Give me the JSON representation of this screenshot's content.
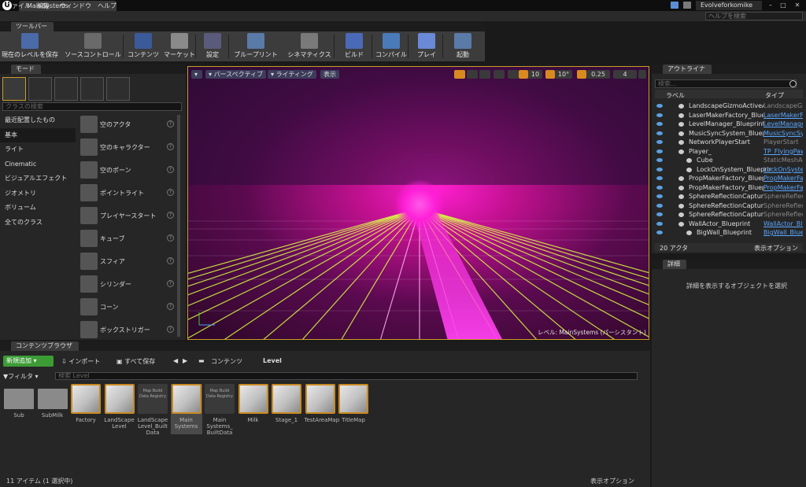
{
  "titlebar": {
    "tab": "MainSystems",
    "user": "Evolveforkomike",
    "help_placeholder": "ヘルプを検索"
  },
  "menu": [
    "ファイル",
    "編集",
    "ウィンドウ",
    "ヘルプ"
  ],
  "toolbar": {
    "header": "ツールバー",
    "buttons": [
      {
        "label": "現在のレベルを保存",
        "icon": "save-icon",
        "color": "#4a6aa8"
      },
      {
        "label": "ソースコントロール",
        "icon": "source-control-icon",
        "color": "#6a6a6a"
      },
      {
        "label": "コンテンツ",
        "icon": "content-icon",
        "color": "#3a5a9a"
      },
      {
        "label": "マーケット",
        "icon": "marketplace-icon",
        "color": "#8a8a8a"
      },
      {
        "label": "設定",
        "icon": "settings-icon",
        "color": "#5a5a7a"
      },
      {
        "label": "ブループリント",
        "icon": "blueprint-icon",
        "color": "#5a7aa8"
      },
      {
        "label": "シネマティクス",
        "icon": "cinematics-icon",
        "color": "#7a7a7a"
      },
      {
        "label": "ビルド",
        "icon": "build-icon",
        "color": "#4a6ab8"
      },
      {
        "label": "コンパイル",
        "icon": "compile-icon",
        "color": "#4a7ab8"
      },
      {
        "label": "プレイ",
        "icon": "play-icon",
        "color": "#6a8ad8"
      },
      {
        "label": "起動",
        "icon": "launch-icon",
        "color": "#5a7aa8"
      }
    ]
  },
  "modes": {
    "header": "モード",
    "search_placeholder": "クラスの検索",
    "categories": [
      "最近配置したもの",
      "基本",
      "ライト",
      "Cinematic",
      "ビジュアルエフェクト",
      "ジオメトリ",
      "ボリューム",
      "全てのクラス"
    ],
    "items": [
      "空のアクタ",
      "空のキャラクター",
      "空のポーン",
      "ポイントライト",
      "プレイヤースタート",
      "キューブ",
      "スフィア",
      "シリンダー",
      "コーン",
      "ボックストリガー"
    ]
  },
  "viewport": {
    "perspective": "パースペクティブ",
    "lighting": "ライティング",
    "show": "表示",
    "grid": "10",
    "angle": "10°",
    "scale": "0.25",
    "cam": "4",
    "level_label": "レベル: MainSystems (パーシスタント)"
  },
  "outliner": {
    "header": "アウトライナ",
    "search_placeholder": "検索...",
    "col_label": "ラベル",
    "col_type": "タイプ",
    "rows": [
      {
        "label": "LandscapeGizmoActiveActor",
        "type": "LandscapeGizmo",
        "link": false
      },
      {
        "label": "LaserMakerFactory_Blueprint",
        "type": "LaserMakerFac",
        "link": true
      },
      {
        "label": "LevelManager_Blueprint",
        "type": "LevelManager",
        "link": true
      },
      {
        "label": "MusicSyncSystem_Blueprint",
        "type": "MusicSyncSy",
        "link": true
      },
      {
        "label": "NetworkPlayerStart",
        "type": "PlayerStart",
        "link": false
      },
      {
        "label": "Player_",
        "type": "TP_FlyingPaw",
        "link": true
      },
      {
        "label": "Cube",
        "type": "StaticMeshActo",
        "link": false
      },
      {
        "label": "LockOnSystem_Blueprint",
        "type": "LockOnSyster",
        "link": true
      },
      {
        "label": "PropMakerFactory_Blueprint",
        "type": "PropMakerFac",
        "link": true
      },
      {
        "label": "PropMakerFactory_Blueprint",
        "type": "PropMakerFac",
        "link": true
      },
      {
        "label": "SphereReflectionCaptureCer",
        "type": "SphereReflecti",
        "link": false
      },
      {
        "label": "SphereReflectionCaptureLef",
        "type": "SphereReflecti",
        "link": false
      },
      {
        "label": "SphereReflectionCaptureRig",
        "type": "SphereReflecti",
        "link": false
      },
      {
        "label": "WallActor_Blueprint",
        "type": "WallActor_Blu",
        "link": true
      },
      {
        "label": "BigWall_Blueprint",
        "type": "BigWall_Bluep",
        "link": true
      }
    ],
    "count": "20 アクタ",
    "view_options": "表示オプション"
  },
  "details": {
    "header": "詳細",
    "empty": "詳細を表示するオブジェクトを選択"
  },
  "content_browser": {
    "header": "コンテンツブラウザ",
    "add_new": "新規追加",
    "import": "インポート",
    "save_all": "すべて保存",
    "path_root": "コンテンツ",
    "path_level": "Level",
    "filter": "フィルタ",
    "search_placeholder": "検索 Level",
    "assets": [
      {
        "name": "Sub",
        "kind": "folder"
      },
      {
        "name": "SubMilk",
        "kind": "folder"
      },
      {
        "name": "Factory",
        "kind": "map"
      },
      {
        "name": "LandScape Level",
        "kind": "map"
      },
      {
        "name": "LandScape Level_Built Data",
        "kind": "registry",
        "sub": "Map Build Data Registry"
      },
      {
        "name": "Main Systems",
        "kind": "map",
        "selected": true
      },
      {
        "name": "Main Systems_ BuiltData",
        "kind": "registry",
        "sub": "Map Build Data Registry"
      },
      {
        "name": "Milk",
        "kind": "map"
      },
      {
        "name": "Stage_1",
        "kind": "map"
      },
      {
        "name": "TestAreaMap",
        "kind": "map"
      },
      {
        "name": "TitleMap",
        "kind": "map"
      }
    ],
    "status": "11 アイテム (1 選択中)",
    "view_options": "表示オプション"
  }
}
